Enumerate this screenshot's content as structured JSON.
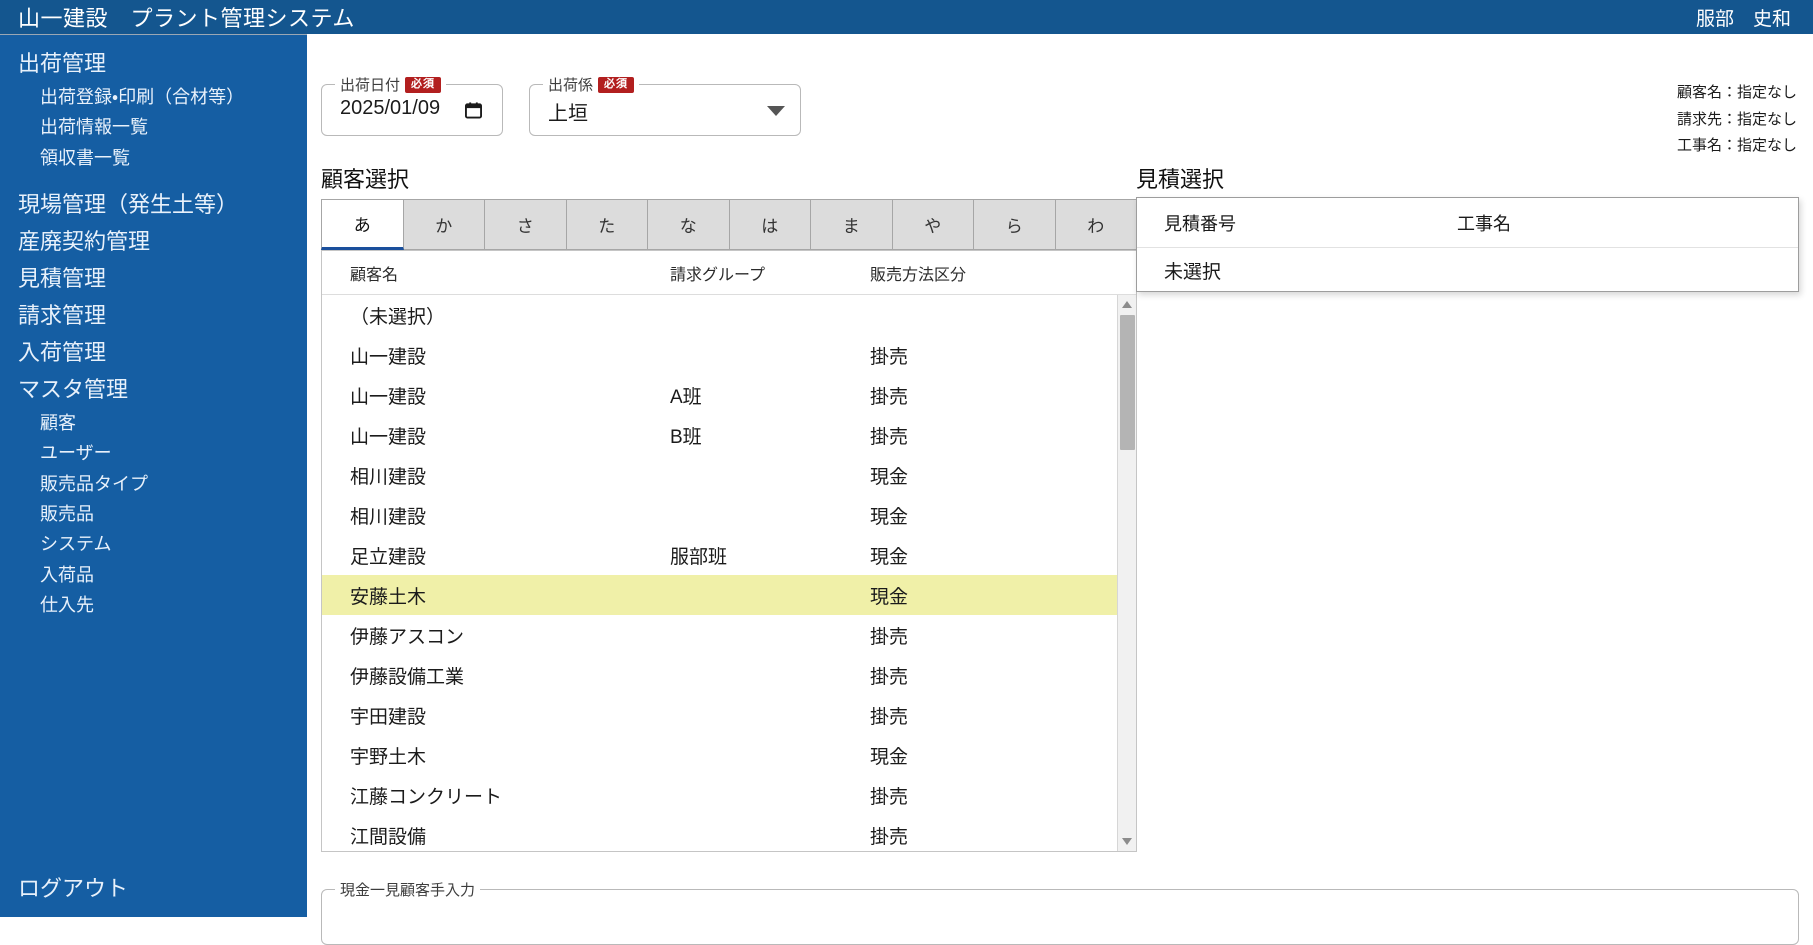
{
  "header": {
    "app_title": "山一建設　プラント管理システム",
    "user_name": "服部　史和"
  },
  "sidebar": {
    "groups": [
      {
        "label": "出荷管理",
        "children": [
          "出荷登録・印刷（合材等）",
          "出荷情報一覧",
          "領収書一覧"
        ]
      },
      {
        "label": "現場管理（発生土等）",
        "children": []
      },
      {
        "label": "産廃契約管理",
        "children": []
      },
      {
        "label": "見積管理",
        "children": []
      },
      {
        "label": "請求管理",
        "children": []
      },
      {
        "label": "入荷管理",
        "children": []
      },
      {
        "label": "マスタ管理",
        "children": [
          "顧客",
          "ユーザー",
          "販売品タイプ",
          "販売品",
          "システム",
          "入荷品",
          "仕入先"
        ]
      }
    ],
    "logout_label": "ログアウト"
  },
  "form": {
    "ship_date": {
      "legend": "出荷日付",
      "required_badge": "必須",
      "value": "2025/01/09",
      "icon": "calendar-icon"
    },
    "ship_clerk": {
      "legend": "出荷係",
      "required_badge": "必須",
      "value": "上垣",
      "icon": "chevron-down-icon"
    }
  },
  "info": {
    "lines": [
      "顧客名：指定なし",
      "請求先：指定なし",
      "工事名：指定なし"
    ]
  },
  "customer_section": {
    "title": "顧客選択",
    "kana_tabs": [
      "あ",
      "か",
      "さ",
      "た",
      "な",
      "は",
      "ま",
      "や",
      "ら",
      "わ"
    ],
    "active_tab": "あ",
    "columns": [
      "顧客名",
      "請求グループ",
      "販売方法区分"
    ],
    "rows": [
      {
        "name": "（未選択）",
        "group": "",
        "method": "",
        "selected": false
      },
      {
        "name": "山一建設",
        "group": "",
        "method": "掛売",
        "selected": false
      },
      {
        "name": "山一建設",
        "group": "A班",
        "method": "掛売",
        "selected": false
      },
      {
        "name": "山一建設",
        "group": "B班",
        "method": "掛売",
        "selected": false
      },
      {
        "name": "相川建設",
        "group": "",
        "method": "現金",
        "selected": false
      },
      {
        "name": "相川建設",
        "group": "",
        "method": "現金",
        "selected": false
      },
      {
        "name": "足立建設",
        "group": "服部班",
        "method": "現金",
        "selected": false
      },
      {
        "name": "安藤土木",
        "group": "",
        "method": "現金",
        "selected": true
      },
      {
        "name": "伊藤アスコン",
        "group": "",
        "method": "掛売",
        "selected": false
      },
      {
        "name": "伊藤設備工業",
        "group": "",
        "method": "掛売",
        "selected": false
      },
      {
        "name": "宇田建設",
        "group": "",
        "method": "掛売",
        "selected": false
      },
      {
        "name": "宇野土木",
        "group": "",
        "method": "現金",
        "selected": false
      },
      {
        "name": "江藤コンクリート",
        "group": "",
        "method": "掛売",
        "selected": false
      },
      {
        "name": "江間設備",
        "group": "",
        "method": "掛売",
        "selected": false
      }
    ]
  },
  "quote_section": {
    "title": "見積選択",
    "columns": [
      "見積番号",
      "工事名"
    ],
    "rows": [
      {
        "number": "未選択",
        "work_name": ""
      }
    ]
  },
  "cash_input": {
    "legend": "現金一見顧客手入力",
    "value": ""
  },
  "colors": {
    "topbar": "#14568f",
    "sidebar": "#155ea3",
    "required_badge": "#b21f1f",
    "selected_row": "#f0f0a8",
    "tab_active_underline": "#1a4f9c"
  }
}
